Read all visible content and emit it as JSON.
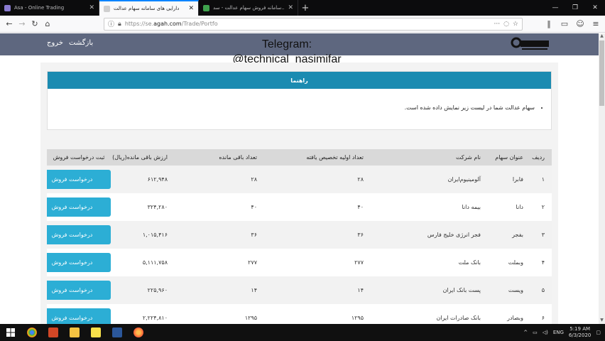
{
  "browser": {
    "tabs": [
      {
        "title": "Asa - Online Trading",
        "favicon_color": "#8a7bd1",
        "active": false
      },
      {
        "title": "دارایی های سامانه سهام عدالت",
        "favicon_color": "#cfcfcf",
        "active": true
      },
      {
        "title": "سامانه فروش سهام عدالت - سد...",
        "favicon_color": "#3fa34d",
        "active": false
      }
    ],
    "url_prefix": "https://se.",
    "url_host": "agah.com",
    "url_path": "/Trade/Portfo"
  },
  "header": {
    "back_label": "بازگشت",
    "logout_label": "خروج",
    "logo_text": "آگاه"
  },
  "overlay": {
    "line1": "Telegram:",
    "line2": "@technical_nasimifar"
  },
  "guide": {
    "title": "راهنما",
    "text": "سهام عدالت شما در لیست زیر نمایش داده شده است."
  },
  "table": {
    "headers": {
      "row": "ردیف",
      "symbol": "عنوان سهام",
      "company": "نام شرکت",
      "initial": "تعداد اولیه تخصیص یافته",
      "remaining": "تعداد باقی مانده",
      "value": "ارزش باقی مانده(ریال)",
      "action": "ثبت درخواست فروش"
    },
    "sell_button_label": "درخواست فروش",
    "rows": [
      {
        "row": "۱",
        "symbol": "فابرا",
        "company": "آلومینیوم‌ایران",
        "initial": "۲۸",
        "remaining": "۲۸",
        "value": "۶۱۲,۹۴۸"
      },
      {
        "row": "۲",
        "symbol": "دانا",
        "company": "بیمه دانا",
        "initial": "۴۰",
        "remaining": "۴۰",
        "value": "۳۲۴,۲۸۰"
      },
      {
        "row": "۳",
        "symbol": "بفجر",
        "company": "فجر انرژی خلیج فارس",
        "initial": "۳۶",
        "remaining": "۳۶",
        "value": "۱,۰۱۵,۴۱۶"
      },
      {
        "row": "۴",
        "symbol": "وبملت",
        "company": "بانک ملت",
        "initial": "۲۷۷",
        "remaining": "۲۷۷",
        "value": "۵,۱۱۱,۷۵۸"
      },
      {
        "row": "۵",
        "symbol": "ویست",
        "company": "پست بانک ایران",
        "initial": "۱۴",
        "remaining": "۱۴",
        "value": "۲۲۵,۹۶۰"
      },
      {
        "row": "۶",
        "symbol": "وبصادر",
        "company": "بانک صادرات ایران",
        "initial": "۱۲۹۵",
        "remaining": "۱۲۹۵",
        "value": "۲,۲۲۴,۸۱۰"
      }
    ]
  },
  "taskbar": {
    "language": "ENG",
    "time": "5:19 AM",
    "date": "6/3/2020"
  }
}
